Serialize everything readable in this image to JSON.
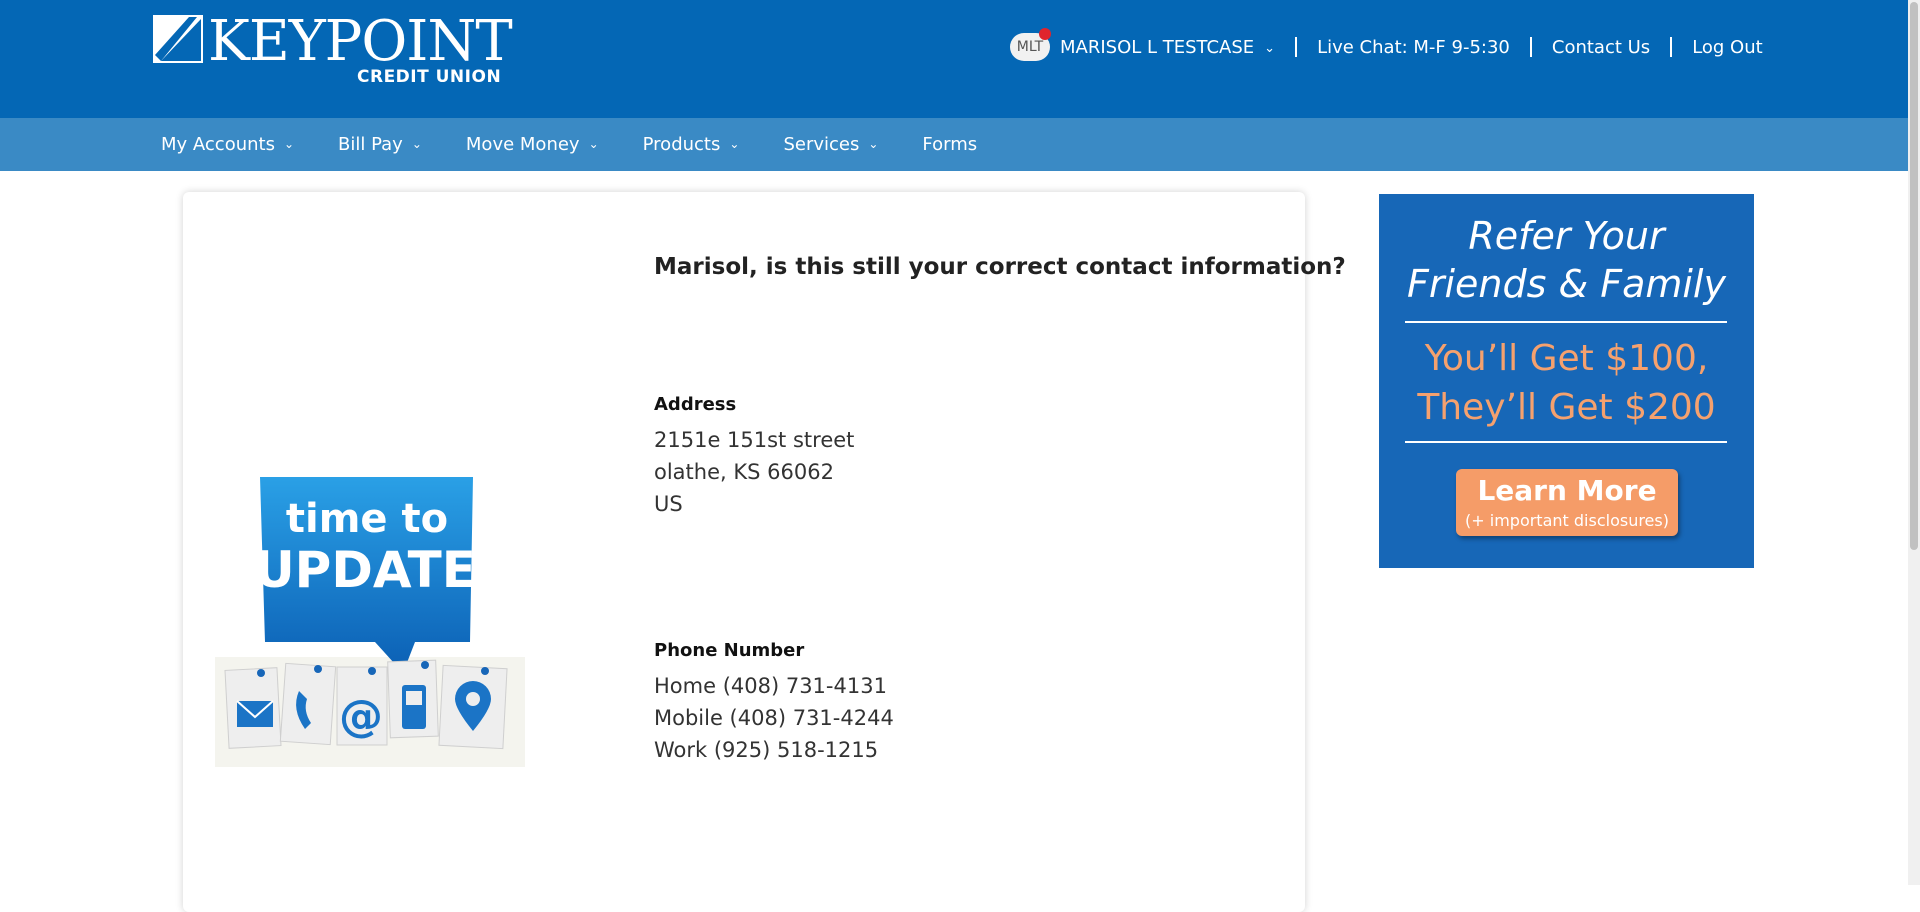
{
  "header": {
    "logo": {
      "name": "KEYPOINT",
      "sub": "CREDIT UNION"
    },
    "user": {
      "initials": "MLT",
      "name": "MARISOL L TESTCASE"
    },
    "links": [
      "Live Chat: M-F 9-5:30",
      "Contact Us",
      "Log Out"
    ]
  },
  "nav": {
    "items": [
      {
        "label": "My Accounts",
        "dropdown": true
      },
      {
        "label": "Bill Pay",
        "dropdown": true
      },
      {
        "label": "Move Money",
        "dropdown": true
      },
      {
        "label": "Products",
        "dropdown": true
      },
      {
        "label": "Services",
        "dropdown": true
      },
      {
        "label": "Forms",
        "dropdown": false
      }
    ]
  },
  "card": {
    "question": "Marisol, is this still your correct contact information?",
    "image": {
      "line1": "time to",
      "line2": "UPDATE"
    },
    "address": {
      "label": "Address",
      "lines": [
        "2151e 151st street",
        "olathe, KS 66062",
        "US"
      ]
    },
    "phone": {
      "label": "Phone Number",
      "lines": [
        "Home (408) 731-4131",
        "Mobile (408) 731-4244",
        "Work (925) 518-1215"
      ]
    }
  },
  "ad": {
    "title_line1": "Refer Your",
    "title_line2": "Friends & Family",
    "offer_line1": "You’ll Get $100,",
    "offer_line2": "They’ll Get $200",
    "button_main": "Learn More",
    "button_sub": "(+ important disclosures)"
  },
  "colors": {
    "header_bg": "#0467b5",
    "nav_bg": "#3a8ac5",
    "ad_bg": "#1767b7",
    "ad_accent": "#f59c68"
  }
}
